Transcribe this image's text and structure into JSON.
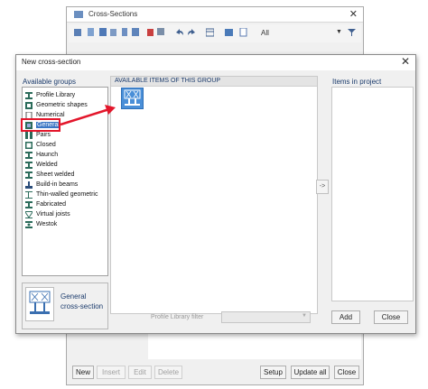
{
  "background_window": {
    "title": "Cross-Sections",
    "toolbar_filter": "All",
    "buttons": {
      "new": "New",
      "insert": "Insert",
      "edit": "Edit",
      "delete": "Delete",
      "setup": "Setup",
      "update_all": "Update all",
      "close": "Close"
    }
  },
  "dialog": {
    "title": "New cross-section",
    "available_groups_label": "Available groups",
    "available_items_label": "AVAILABLE ITEMS OF THIS GROUP",
    "items_in_project_label": "Items in project",
    "groups": [
      {
        "label": "Profile Library",
        "icon": "i-beam-icon"
      },
      {
        "label": "Geometric shapes",
        "icon": "geometric-shapes-icon"
      },
      {
        "label": "Numerical",
        "icon": "numerical-icon"
      },
      {
        "label": "General",
        "icon": "general-section-icon",
        "selected": true
      },
      {
        "label": "Pairs",
        "icon": "pairs-icon"
      },
      {
        "label": "Closed",
        "icon": "closed-section-icon"
      },
      {
        "label": "Haunch",
        "icon": "haunch-icon"
      },
      {
        "label": "Welded",
        "icon": "welded-icon"
      },
      {
        "label": "Sheet welded",
        "icon": "sheet-welded-icon"
      },
      {
        "label": "Build-in beams",
        "icon": "build-in-beam-icon"
      },
      {
        "label": "Thin-walled geometric",
        "icon": "thin-walled-icon"
      },
      {
        "label": "Fabricated",
        "icon": "fabricated-icon"
      },
      {
        "label": "Virtual joists",
        "icon": "virtual-joist-icon"
      },
      {
        "label": "Westok",
        "icon": "westok-icon"
      }
    ],
    "preview_text": "General cross-section",
    "profile_filter_label": "Profile Library filter",
    "transfer_button": "->",
    "add_button": "Add",
    "close_button": "Close"
  },
  "colors": {
    "annotation_red": "#e3162b",
    "selection_blue": "#3a75c4",
    "tile_blue": "#4a8fd8"
  }
}
